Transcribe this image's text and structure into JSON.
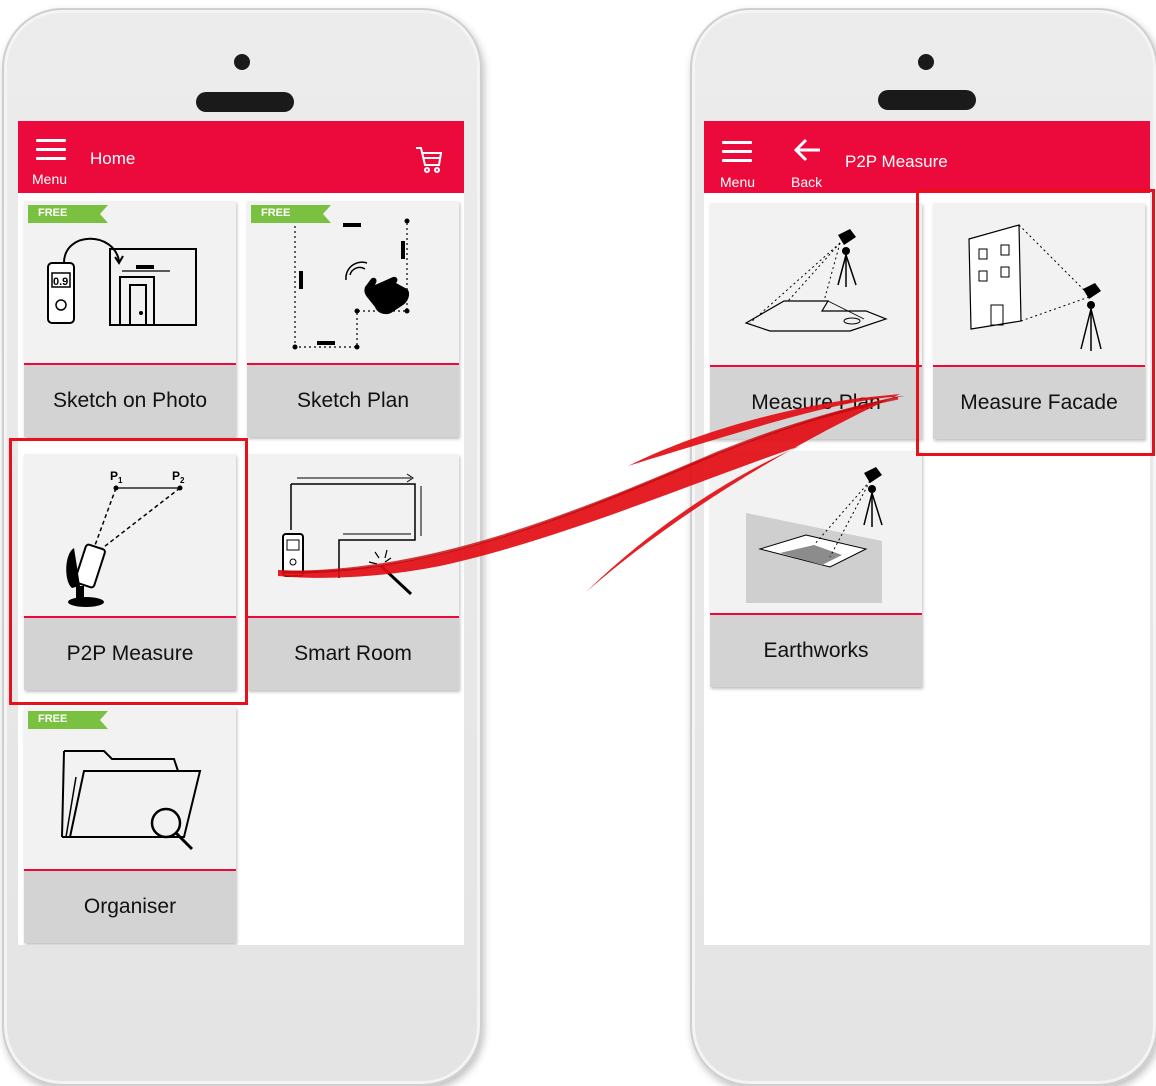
{
  "left_screen": {
    "menu_label": "Menu",
    "title": "Home",
    "cart_icon": "cart-icon",
    "tiles": [
      {
        "label": "Sketch on Photo",
        "badge": "FREE"
      },
      {
        "label": "Sketch Plan",
        "badge": "FREE"
      },
      {
        "label": "P2P Measure",
        "p1": "P",
        "p1_sub": "1",
        "p2": "P",
        "p2_sub": "2"
      },
      {
        "label": "Smart Room"
      },
      {
        "label": "Organiser",
        "badge": "FREE"
      }
    ],
    "device_reading": "0.9"
  },
  "right_screen": {
    "menu_label": "Menu",
    "back_label": "Back",
    "title": "P2P Measure",
    "tiles": [
      {
        "label": "Measure Plan"
      },
      {
        "label": "Measure Facade"
      },
      {
        "label": "Earthworks"
      }
    ]
  },
  "colors": {
    "accent": "#ec0a3c",
    "highlight": "#e8101c",
    "tile_bg": "#f2f2f2",
    "label_bg": "#d3d3d3"
  }
}
